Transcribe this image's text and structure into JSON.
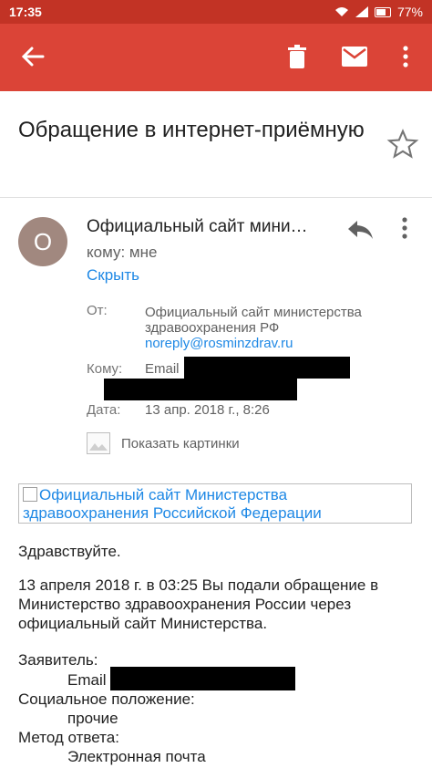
{
  "status": {
    "time": "17:35",
    "battery": "77%"
  },
  "toolbar": {
    "back": "back-icon",
    "delete": "trash-icon",
    "mark_unread": "mail-icon",
    "more": "more-vert-icon"
  },
  "email": {
    "subject": "Обращение в интернет-приёмную",
    "avatar_letter": "О",
    "sender_short": "Официальный сайт мини…",
    "to_line": "кому: мне",
    "hide_link": "Скрыть",
    "details": {
      "from_label": "От:",
      "from_name": "Официальный сайт министерства здравоохранения РФ",
      "from_email": "noreply@rosminzdrav.ru",
      "to_label": "Кому:",
      "to_value": "Email",
      "date_label": "Дата:",
      "date_value": "13 апр. 2018 г., 8:26"
    },
    "show_images": "Показать картинки",
    "broken_image_alt": "Официальный сайт Министерства здравоохранения Российской Федерации",
    "body": {
      "greeting": "Здравствуйте.",
      "paragraph": "13 апреля 2018 г. в 03:25 Вы подали обращение в Министерство здравоохранения России через официальный сайт Министерства.",
      "applicant_label": "Заявитель:",
      "applicant_email_label": "Email",
      "social_label": "Социальное положение:",
      "social_value": "прочие",
      "method_label": "Метод ответа:",
      "method_value": "Электронная почта"
    }
  },
  "colors": {
    "appbar": "#db4437",
    "statusbar": "#c23325",
    "link": "#1e88e5",
    "avatar": "#a1887f"
  }
}
